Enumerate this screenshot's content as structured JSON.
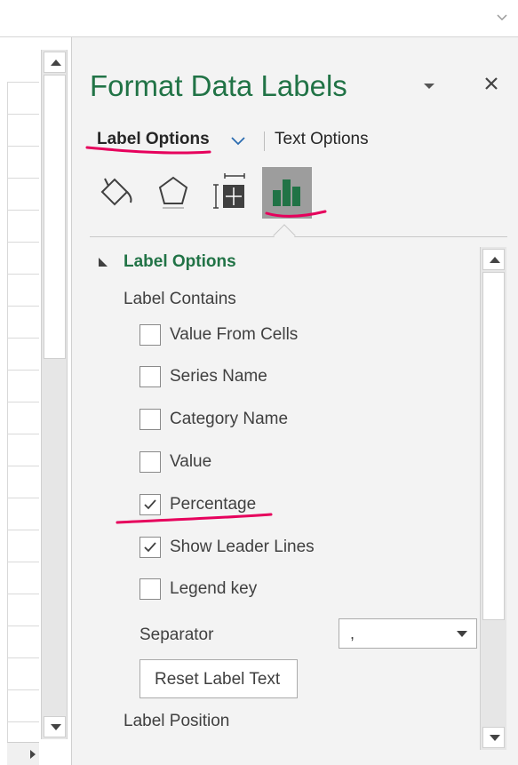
{
  "pane": {
    "title": "Format Data Labels",
    "tabs": {
      "label_options": "Label Options",
      "text_options": "Text Options"
    },
    "icons": [
      "fill-line-icon",
      "effects-icon",
      "size-properties-icon",
      "label-options-icon"
    ]
  },
  "section": {
    "title": "Label Options",
    "label_contains": "Label Contains",
    "checkboxes": [
      {
        "label": "Value From Cells",
        "checked": false
      },
      {
        "label": "Series Name",
        "checked": false
      },
      {
        "label": "Category Name",
        "checked": false
      },
      {
        "label": "Value",
        "checked": false
      },
      {
        "label": "Percentage",
        "checked": true
      },
      {
        "label": "Show Leader Lines",
        "checked": true
      },
      {
        "label": "Legend key",
        "checked": false
      }
    ],
    "separator_label": "Separator",
    "separator_value": ",",
    "reset_button": "Reset Label Text",
    "label_position": "Label Position"
  },
  "colors": {
    "accent_green": "#217346",
    "annotation_red": "#e6005c"
  }
}
